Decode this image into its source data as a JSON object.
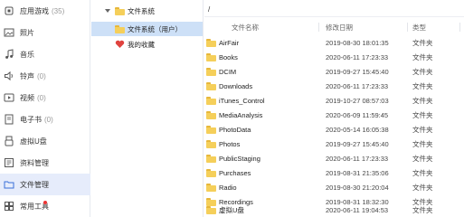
{
  "sidebar": {
    "items": [
      {
        "label": "应用游戏",
        "count": "(35)",
        "icon": "apps-icon"
      },
      {
        "label": "照片",
        "count": "",
        "icon": "photo-icon"
      },
      {
        "label": "音乐",
        "count": "",
        "icon": "music-icon"
      },
      {
        "label": "铃声",
        "count": "(0)",
        "icon": "ringtone-icon"
      },
      {
        "label": "视频",
        "count": "(0)",
        "icon": "video-icon"
      },
      {
        "label": "电子书",
        "count": "(0)",
        "icon": "ebook-icon"
      },
      {
        "label": "虚拟U盘",
        "count": "",
        "icon": "virtual-udisk-icon"
      },
      {
        "label": "资料管理",
        "count": "",
        "icon": "data-manage-icon"
      },
      {
        "label": "文件管理",
        "count": "",
        "icon": "file-manage-icon"
      },
      {
        "label": "常用工具",
        "count": "",
        "icon": "tools-icon"
      }
    ],
    "active_index": 8
  },
  "tree": {
    "root": "文件系统",
    "child": "文件系统（用户）",
    "favorites": "我的收藏"
  },
  "pane": {
    "path": "/",
    "columns": {
      "name": "文件名称",
      "date": "修改日期",
      "type": "类型"
    },
    "files": [
      {
        "name": "AirFair",
        "date": "2019-08-30 18:01:35",
        "type": "文件夹"
      },
      {
        "name": "Books",
        "date": "2020-06-11 17:23:33",
        "type": "文件夹"
      },
      {
        "name": "DCIM",
        "date": "2019-09-27 15:45:40",
        "type": "文件夹"
      },
      {
        "name": "Downloads",
        "date": "2020-06-11 17:23:33",
        "type": "文件夹"
      },
      {
        "name": "iTunes_Control",
        "date": "2019-10-27 08:57:03",
        "type": "文件夹"
      },
      {
        "name": "MediaAnalysis",
        "date": "2020-06-09 11:59:45",
        "type": "文件夹"
      },
      {
        "name": "PhotoData",
        "date": "2020-05-14 16:05:38",
        "type": "文件夹"
      },
      {
        "name": "Photos",
        "date": "2019-09-27 15:45:40",
        "type": "文件夹"
      },
      {
        "name": "PublicStaging",
        "date": "2020-06-11 17:23:33",
        "type": "文件夹"
      },
      {
        "name": "Purchases",
        "date": "2019-08-31 21:35:06",
        "type": "文件夹"
      },
      {
        "name": "Radio",
        "date": "2019-08-30 21:20:04",
        "type": "文件夹"
      },
      {
        "name": "Recordings",
        "date": "2019-08-31 18:32:30",
        "type": "文件夹"
      },
      {
        "name": "虚拟U盘",
        "date": "2020-06-11 19:04:53",
        "type": "文件夹"
      }
    ]
  },
  "colors": {
    "active_nav": "#e6ecfb",
    "selected_tree": "#cde0f7",
    "folder": "#f5cf5a",
    "badge": "#ee3333"
  }
}
